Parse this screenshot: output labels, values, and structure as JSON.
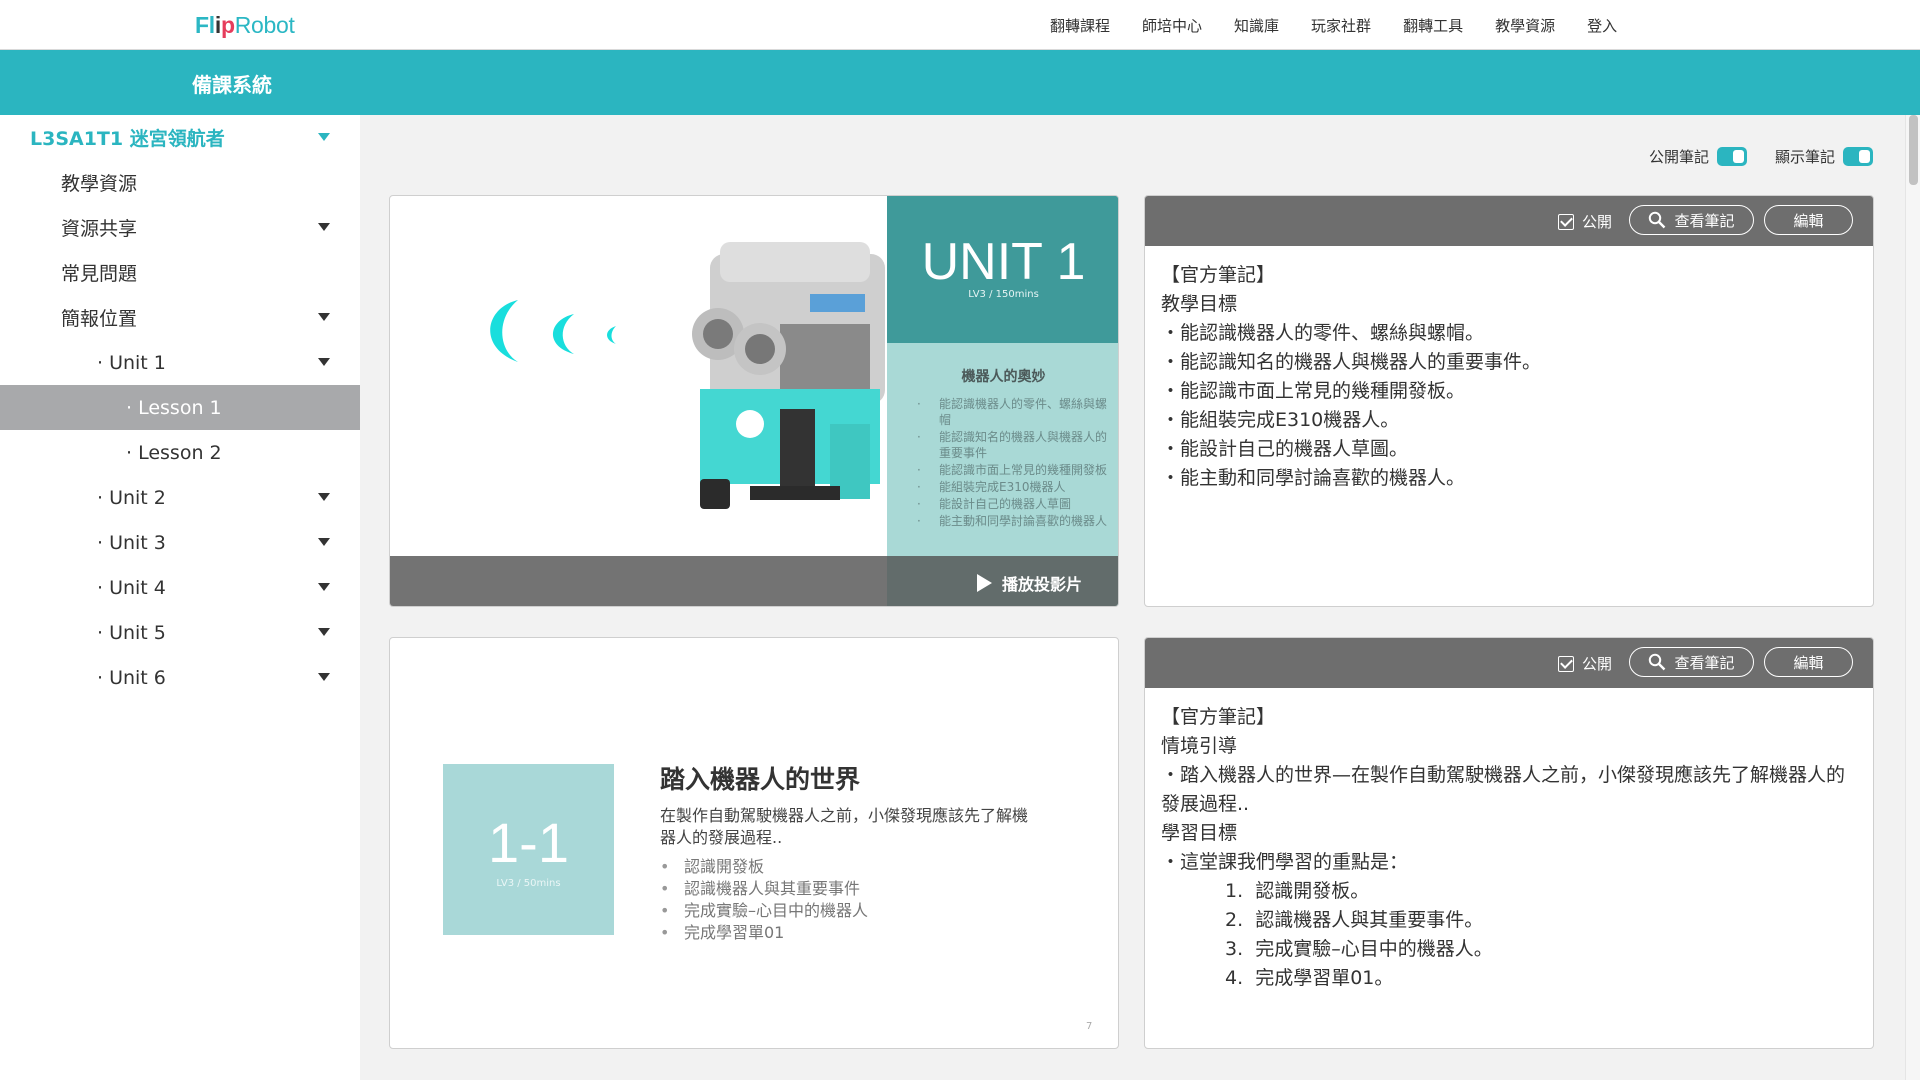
{
  "nav": {
    "logo_prefix": "Fl",
    "logo_mid": "i",
    "logo_p": "p",
    "logo_suffix": "Robot",
    "links": [
      "翻轉課程",
      "師培中心",
      "知識庫",
      "玩家社群",
      "翻轉工具",
      "教學資源",
      "登入"
    ]
  },
  "subbar": {
    "title": "備課系統"
  },
  "sidebar": {
    "items": [
      {
        "label": "L3SA1T1 迷宮領航者",
        "caret": true
      },
      {
        "label": "教學資源",
        "caret": false
      },
      {
        "label": "資源共享",
        "caret": true
      },
      {
        "label": "常見問題",
        "caret": false
      },
      {
        "label": "簡報位置",
        "caret": true
      },
      {
        "label": "· Unit 1",
        "caret": true
      },
      {
        "label": "· Lesson 1",
        "caret": false,
        "active": true
      },
      {
        "label": "· Lesson 2",
        "caret": false
      },
      {
        "label": "· Unit 2",
        "caret": true
      },
      {
        "label": "· Unit 3",
        "caret": true
      },
      {
        "label": "· Unit 4",
        "caret": true
      },
      {
        "label": "· Unit 5",
        "caret": true
      },
      {
        "label": "· Unit 6",
        "caret": true
      }
    ]
  },
  "toggles": {
    "public_label": "公開筆記",
    "show_label": "顯示筆記",
    "public_on": true,
    "show_on": true
  },
  "slide1": {
    "unit_title": "UNIT 1",
    "unit_sub": "LV3 / 150mins",
    "heading": "機器人的奧妙",
    "bullets": [
      "能認識機器人的零件、螺絲與螺帽",
      "能認識知名的機器人與機器人的重要事件",
      "能認識市面上常見的幾種開發板",
      "能組裝完成E310機器人",
      "能設計自己的機器人草圖",
      "能主動和同學討論喜歡的機器人"
    ],
    "play_label": "播放投影片"
  },
  "slide2": {
    "num": "1-1",
    "num_sub": "LV3 / 50mins",
    "title": "踏入機器人的世界",
    "intro": "在製作自動駕駛機器人之前，小傑發現應該先了解機器人的發展過程..",
    "bullets": [
      "認識開發板",
      "認識機器人與其重要事件",
      "完成實驗–心目中的機器人",
      "完成學習單01"
    ],
    "page": "7"
  },
  "note_bar": {
    "public_label": "公開",
    "view_label": "查看筆記",
    "edit_label": "編輯"
  },
  "note1": {
    "header": "【官方筆記】",
    "section": "教學目標",
    "items": [
      "・能認識機器人的零件、螺絲與螺帽。",
      "・能認識知名的機器人與機器人的重要事件。",
      "・能認識市面上常見的幾種開發板。",
      "・能組裝完成E310機器人。",
      "・能設計自己的機器人草圖。",
      "・能主動和同學討論喜歡的機器人。"
    ]
  },
  "note2": {
    "header": "【官方筆記】",
    "section1": "情境引導",
    "para": "・踏入機器人的世界—在製作自動駕駛機器人之前，小傑發現應該先了解機器人的發展過程..",
    "section2": "學習目標",
    "lead": "・這堂課我們學習的重點是：",
    "numbered": [
      "1.  認識開發板。",
      "2.  認識機器人與其重要事件。",
      "3.  完成實驗–心目中的機器人。",
      "4.  完成學習單01。"
    ]
  },
  "colors": {
    "brand": "#2bb5c0",
    "active_item": "#a8a9ab",
    "note_bar": "#6e6e6e"
  }
}
